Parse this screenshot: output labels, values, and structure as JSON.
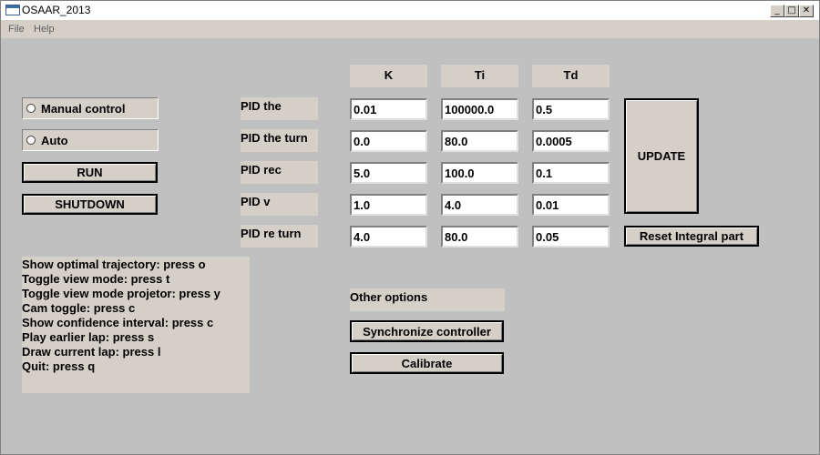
{
  "window": {
    "title": "OSAAR_2013",
    "buttons": {
      "minimize": "_",
      "maximize": "□",
      "close": "✕"
    }
  },
  "menu": [
    "File",
    "Help"
  ],
  "mode": {
    "manual_label": "Manual control",
    "auto_label": "Auto",
    "run_label": "RUN",
    "shutdown_label": "SHUTDOWN"
  },
  "pid": {
    "headers": [
      "K",
      "Ti",
      "Td"
    ],
    "rows": [
      {
        "label": "PID the",
        "k": "0.01",
        "ti": "100000.0",
        "td": "0.5"
      },
      {
        "label": "PID the turn",
        "k": "0.0",
        "ti": "80.0",
        "td": "0.0005"
      },
      {
        "label": "PID rec",
        "k": "5.0",
        "ti": "100.0",
        "td": "0.1"
      },
      {
        "label": "PID v",
        "k": "1.0",
        "ti": "4.0",
        "td": "0.01"
      },
      {
        "label": "PID re turn",
        "k": "4.0",
        "ti": "80.0",
        "td": "0.05"
      }
    ],
    "update_label": "UPDATE",
    "reset_label": "Reset Integral part"
  },
  "help": [
    "Show optimal trajectory: press o",
    "Toggle view mode: press t",
    "Toggle view mode projetor: press y",
    "Cam toggle: press c",
    "Show confidence interval: press c",
    "Play earlier lap: press s",
    "Draw current lap: press l",
    "Quit: press q"
  ],
  "other": {
    "title": "Other options",
    "sync_label": "Synchronize controller",
    "calibrate_label": "Calibrate"
  }
}
